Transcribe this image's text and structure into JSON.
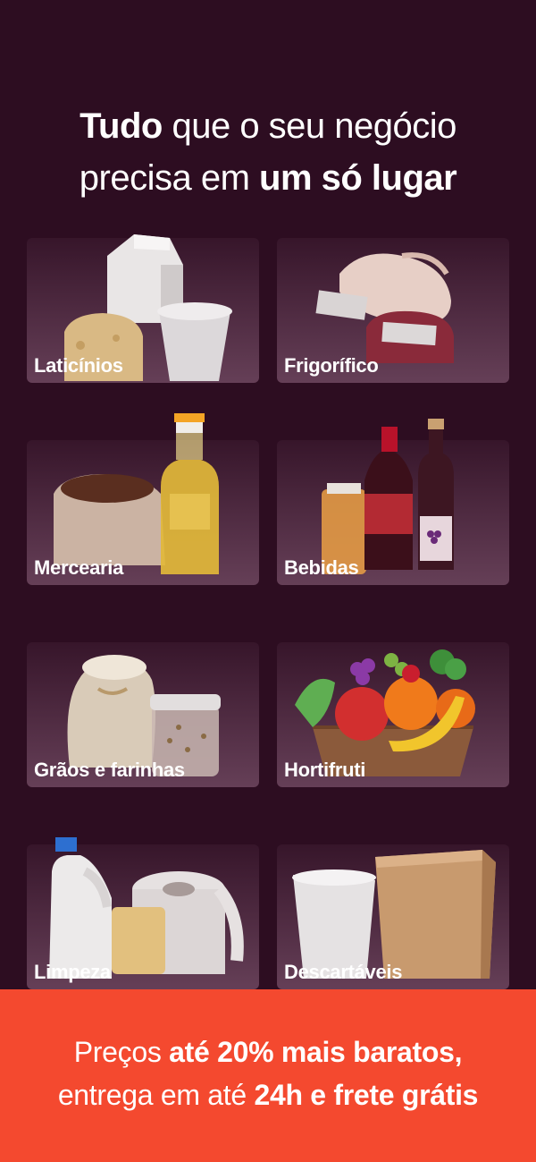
{
  "headline": {
    "line1_bold": "Tudo",
    "line1_rest": " que o seu negócio",
    "line2_rest": "precisa em ",
    "line2_bold": "um só lugar"
  },
  "categories": [
    {
      "label": "Laticínios",
      "icon": "dairy-products-icon"
    },
    {
      "label": "Frigorífico",
      "icon": "meat-poultry-icon"
    },
    {
      "label": "Mercearia",
      "icon": "grocery-sack-oil-icon"
    },
    {
      "label": "Bebidas",
      "icon": "beverages-bottles-icon"
    },
    {
      "label": "Grãos e farinhas",
      "icon": "grains-flour-icon"
    },
    {
      "label": "Hortifruti",
      "icon": "fruit-vegetable-basket-icon"
    },
    {
      "label": "Limpeza",
      "icon": "cleaning-products-icon"
    },
    {
      "label": "Descartáveis",
      "icon": "disposables-cup-box-icon"
    }
  ],
  "footer": {
    "part1": "Preços ",
    "part2_bold": "até 20% mais baratos,",
    "part3": "entrega em até ",
    "part4_bold": "24h e frete grátis"
  },
  "colors": {
    "background": "#2d0d21",
    "footer": "#f4492f",
    "text": "#ffffff"
  }
}
